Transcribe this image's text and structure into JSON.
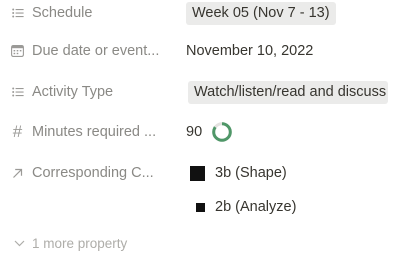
{
  "properties": [
    {
      "name": "Schedule",
      "icon": "list-icon",
      "value": "Week 05 (Nov 7 - 13)"
    },
    {
      "name": "Due date or event...",
      "icon": "calendar-icon",
      "value": "November 10, 2022"
    },
    {
      "name": "Activity Type",
      "icon": "list-icon",
      "value": "Watch/listen/read and discuss"
    },
    {
      "name": "Minutes required ...",
      "icon": "hash-icon",
      "value": "90",
      "progress_ring_color": "#4f9768"
    },
    {
      "name": "Corresponding C...",
      "icon": "relation-arrow-icon",
      "values": [
        "3b (Shape)",
        "2b (Analyze)"
      ]
    }
  ],
  "more_properties_label": "1 more property",
  "colors": {
    "label": "#8a8985",
    "text": "#37352f",
    "tag_bg": "#ebebea",
    "ring": "#4f9768"
  }
}
